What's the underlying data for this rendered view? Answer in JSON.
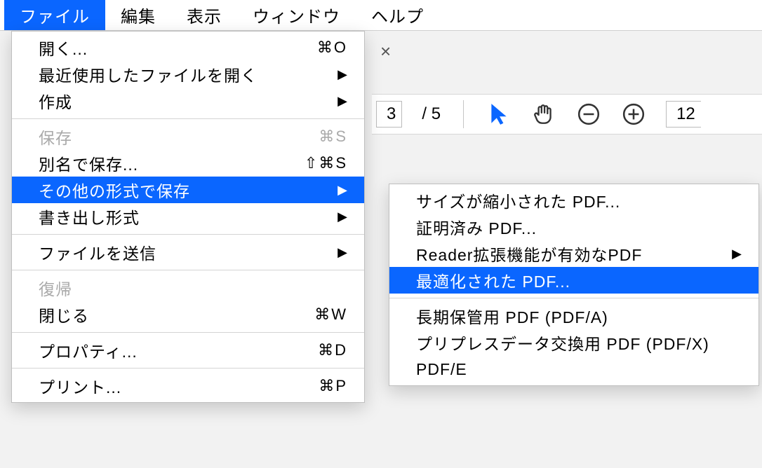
{
  "menubar": {
    "items": [
      {
        "label": "ファイル",
        "selected": true
      },
      {
        "label": "編集"
      },
      {
        "label": "表示"
      },
      {
        "label": "ウィンドウ"
      },
      {
        "label": "ヘルプ"
      }
    ]
  },
  "toolbar": {
    "page_current": "3",
    "page_sep": "/",
    "page_total": "5",
    "zoom_text": "12"
  },
  "file_menu": [
    {
      "label": "開く...",
      "shortcut": "⌘O"
    },
    {
      "label": "最近使用したファイルを開く",
      "submenu": true
    },
    {
      "label": "作成",
      "submenu": true
    },
    {
      "sep": true
    },
    {
      "label": "保存",
      "shortcut": "⌘S",
      "disabled": true
    },
    {
      "label": "別名で保存...",
      "shortcut": "⇧⌘S"
    },
    {
      "label": "その他の形式で保存",
      "submenu": true,
      "selected": true
    },
    {
      "label": "書き出し形式",
      "submenu": true
    },
    {
      "sep": true
    },
    {
      "label": "ファイルを送信",
      "submenu": true
    },
    {
      "sep": true
    },
    {
      "label": "復帰",
      "disabled": true
    },
    {
      "label": "閉じる",
      "shortcut": "⌘W"
    },
    {
      "sep": true
    },
    {
      "label": "プロパティ...",
      "shortcut": "⌘D"
    },
    {
      "sep": true
    },
    {
      "label": "プリント...",
      "shortcut": "⌘P"
    }
  ],
  "save_as_other_menu": [
    {
      "label": "サイズが縮小された PDF..."
    },
    {
      "label": "証明済み PDF..."
    },
    {
      "label": "Reader拡張機能が有効なPDF",
      "submenu": true
    },
    {
      "label": "最適化された PDF...",
      "selected": true
    },
    {
      "sep": true
    },
    {
      "label": "長期保管用 PDF (PDF/A)"
    },
    {
      "label": "プリプレスデータ交換用 PDF (PDF/X)"
    },
    {
      "label": "PDF/E"
    }
  ]
}
